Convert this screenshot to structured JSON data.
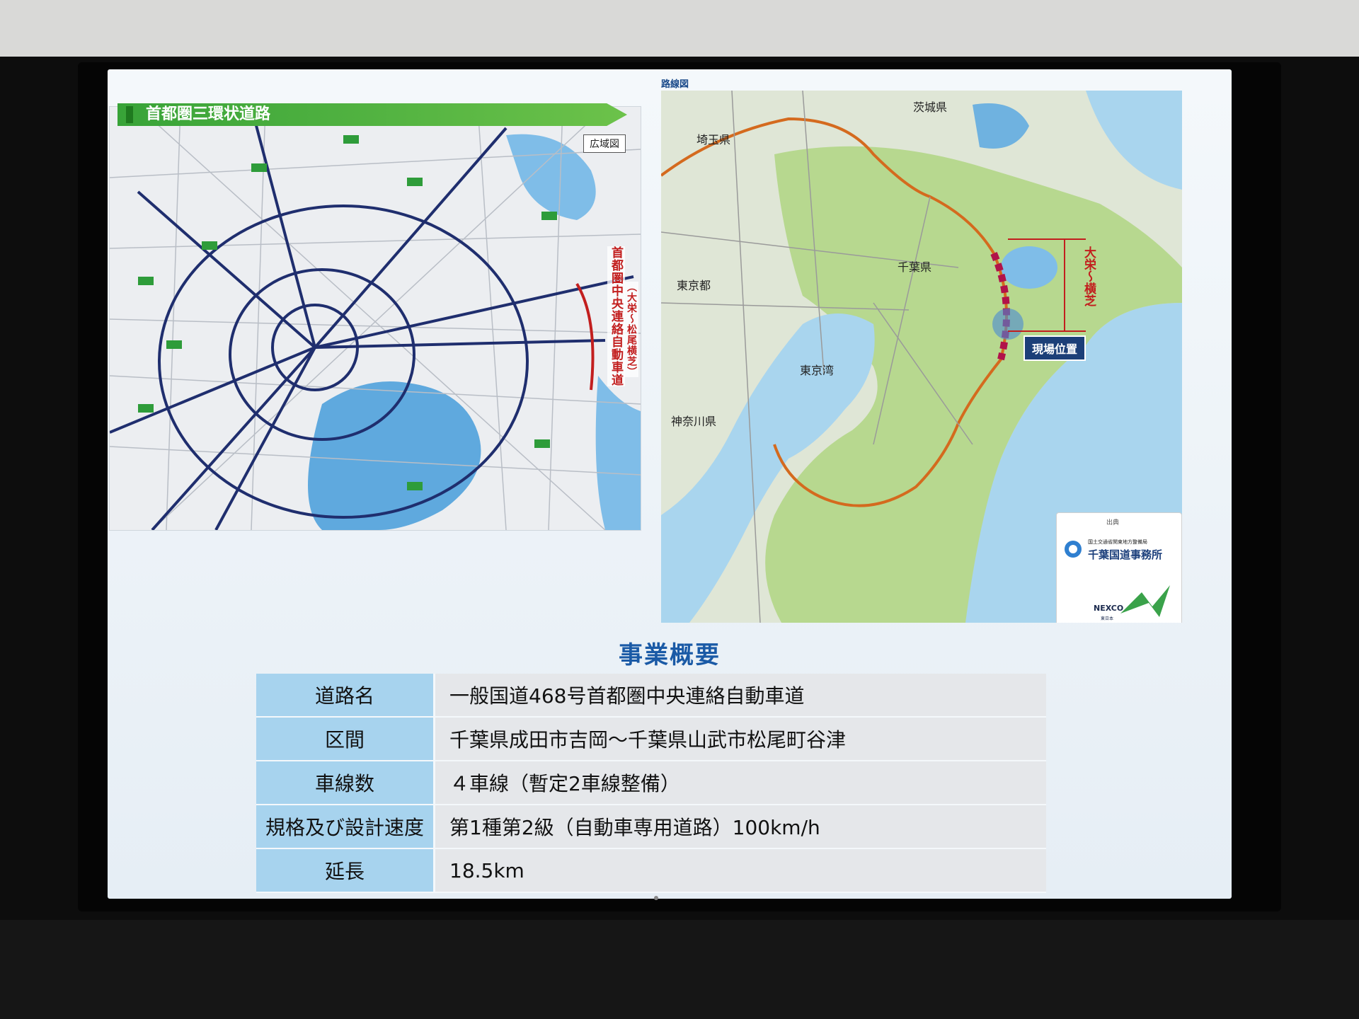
{
  "left_map": {
    "banner_title": "首都圏三環状道路",
    "wide_area_label": "広域図",
    "vertical_label_main": "首都圏中央連絡自動車道",
    "vertical_label_sub": "（大栄〜松尾横芝）"
  },
  "right_map": {
    "title": "路線図",
    "prefectures": {
      "ibaraki": "茨城県",
      "saitama": "埼玉県",
      "tokyo": "東京都",
      "chiba": "千葉県",
      "kanagawa": "神奈川県",
      "bay": "東京湾"
    },
    "section_label": "大栄〜横芝",
    "site_label": "現場位置",
    "source": "出典",
    "bureau": "国土交通省関東地方整備局",
    "office": "千葉国道事務所",
    "nexco": "NEXCO",
    "nexco_sub": "東日本"
  },
  "summary": {
    "heading": "事業概要",
    "rows": [
      {
        "key": "道路名",
        "value": "一般国道468号首都圏中央連絡自動車道"
      },
      {
        "key": "区間",
        "value": "千葉県成田市吉岡〜千葉県山武市松尾町谷津"
      },
      {
        "key": "車線数",
        "value": "４車線（暫定2車線整備）"
      },
      {
        "key": "規格及び設計速度",
        "value": "第1種第2級（自動車専用道路）100km/h"
      },
      {
        "key": "延長",
        "value": "18.5km"
      }
    ]
  }
}
